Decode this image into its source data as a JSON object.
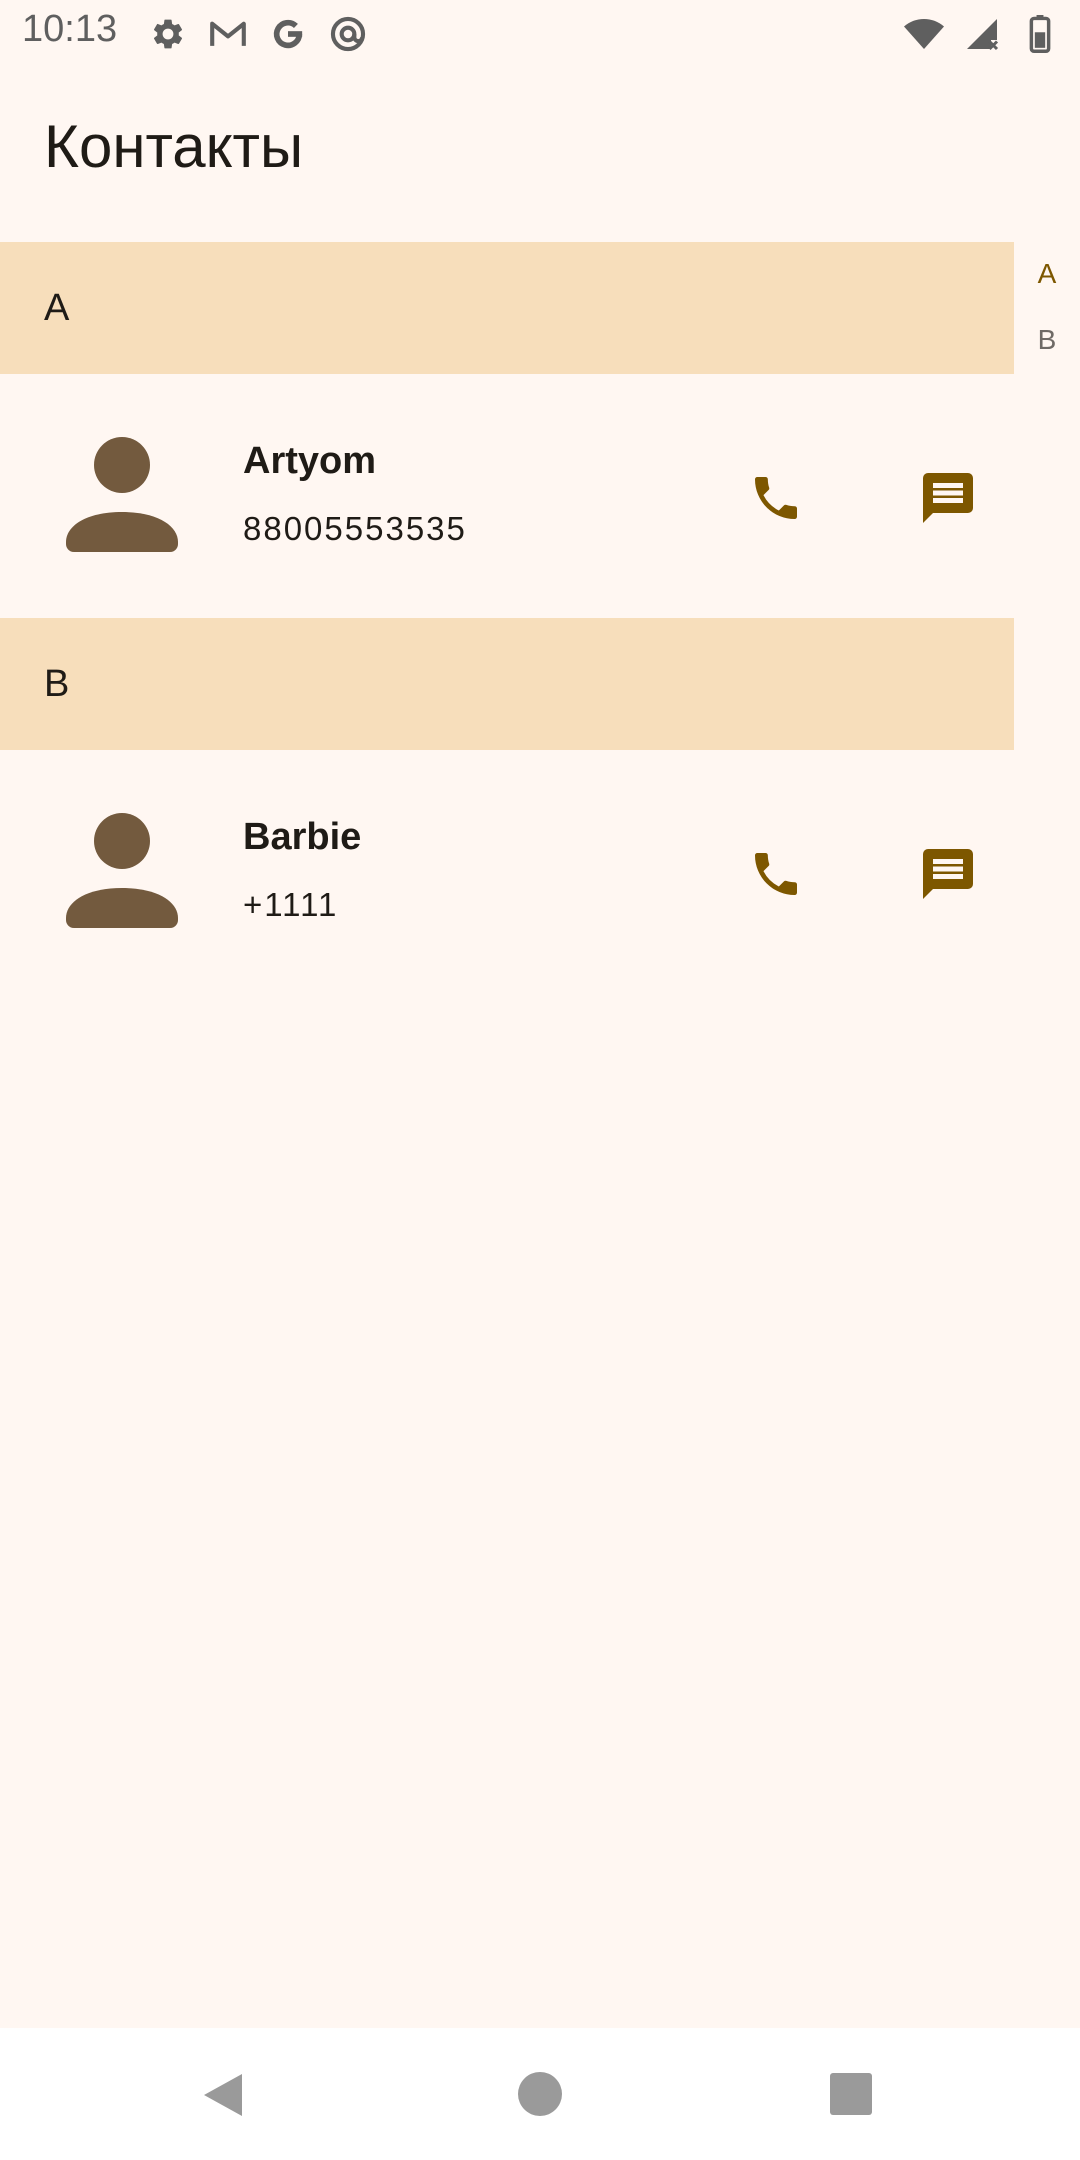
{
  "status_bar": {
    "time": "10:13",
    "left_icons": [
      "settings-icon",
      "gmail-icon",
      "google-icon",
      "at-sign-icon"
    ],
    "right_icons": [
      "wifi-icon",
      "signal-icon",
      "battery-icon"
    ]
  },
  "header": {
    "title": "Контакты"
  },
  "sections": [
    {
      "letter": "A",
      "contacts": [
        {
          "name": "Artyom",
          "phone": "88005553535"
        }
      ]
    },
    {
      "letter": "B",
      "contacts": [
        {
          "name": "Barbie",
          "phone": "+1111"
        }
      ]
    }
  ],
  "alpha_index": {
    "letters": [
      "A",
      "B"
    ],
    "active": "A"
  },
  "colors": {
    "background": "#FFF7F2",
    "section_header": "#F7DEBB",
    "accent": "#7D5700",
    "avatar": "#735A3E"
  },
  "nav_bar": {
    "icons": [
      "back-icon",
      "home-icon",
      "recents-icon"
    ]
  }
}
